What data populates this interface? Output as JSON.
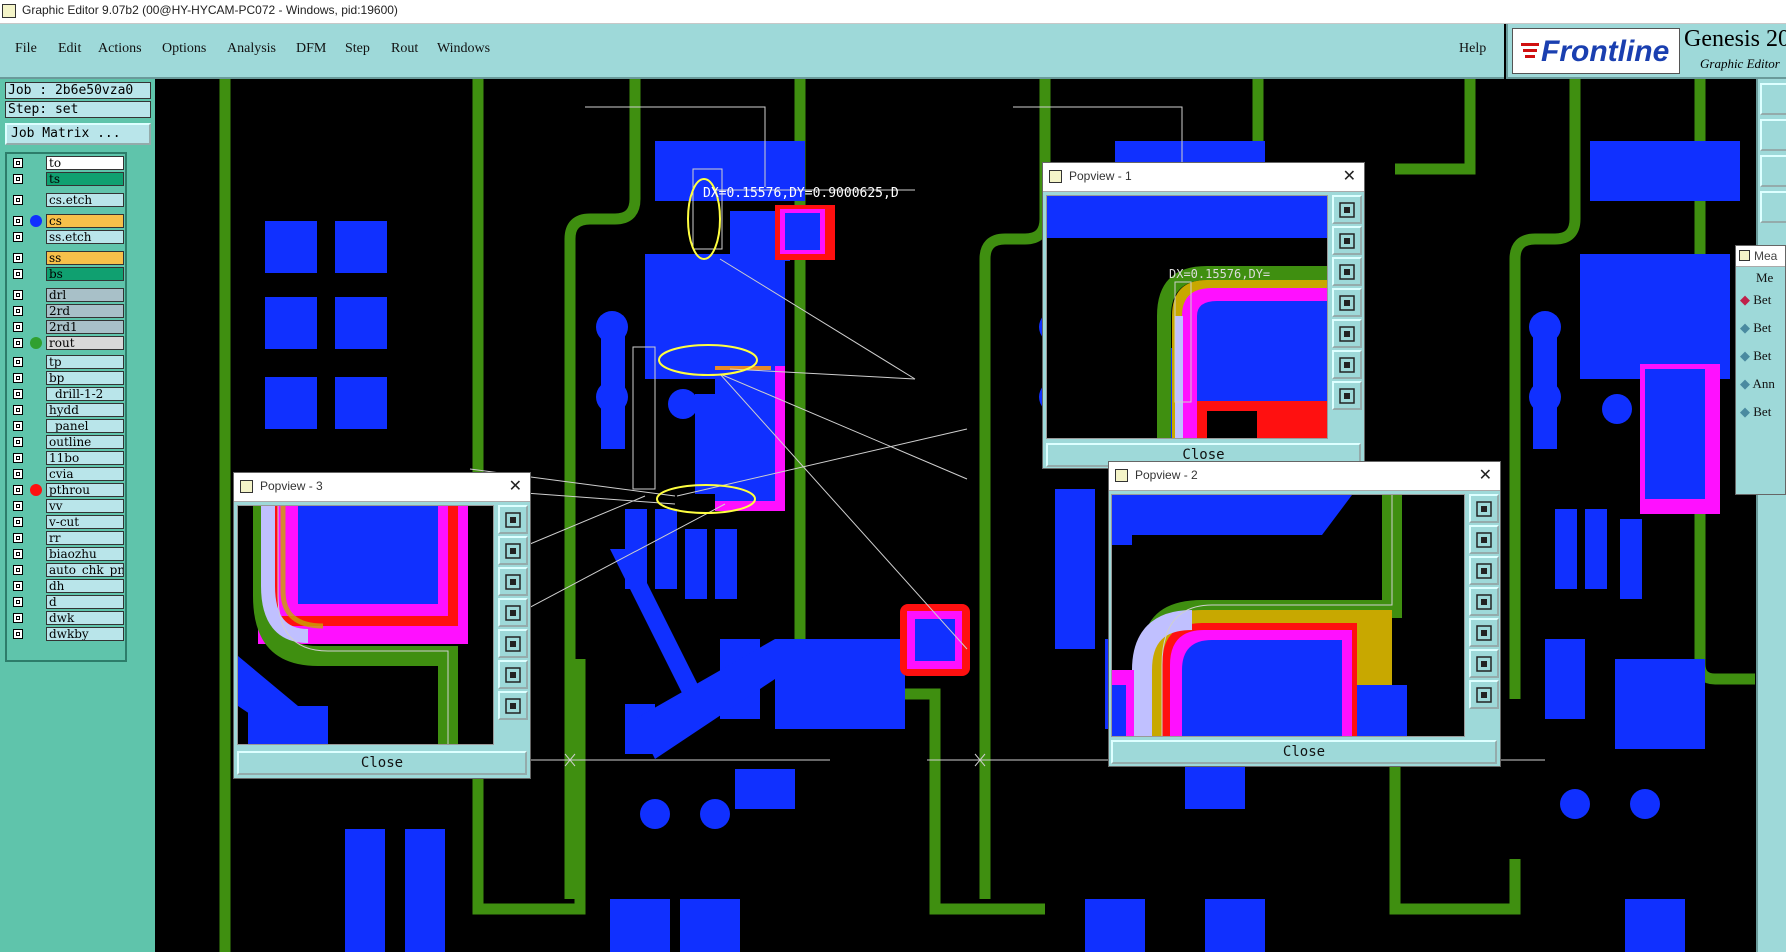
{
  "window": {
    "title": "Graphic Editor 9.07b2 (00@HY-HYCAM-PC072 - Windows, pid:19600)"
  },
  "menu": {
    "file": "File",
    "edit": "Edit",
    "actions": "Actions",
    "options": "Options",
    "analysis": "Analysis",
    "dfm": "DFM",
    "step": "Step",
    "rout": "Rout",
    "windows": "Windows",
    "help": "Help"
  },
  "brand": {
    "logo": "Frontline",
    "product": "Genesis 20",
    "subtitle": "Graphic Editor"
  },
  "job": {
    "job_line": "Job : 2b6e50vza0",
    "step_line": "Step: set",
    "matrix_button": "Job Matrix ..."
  },
  "layers": [
    {
      "name": "to",
      "color": "#ffffff",
      "dot": ""
    },
    {
      "name": "ts",
      "color": "#10a070",
      "dot": ""
    },
    {
      "name": "cs.etch",
      "color": "#b9e5ea",
      "dot": ""
    },
    {
      "name": "cs",
      "color": "#f7c04a",
      "dot": "#1030ff"
    },
    {
      "name": "ss.etch",
      "color": "#b9e5ea",
      "dot": ""
    },
    {
      "name": "ss",
      "color": "#f7c04a",
      "dot": ""
    },
    {
      "name": "bs",
      "color": "#10a070",
      "dot": ""
    },
    {
      "name": "drl",
      "color": "#a8c0c8",
      "dot": ""
    },
    {
      "name": "2rd",
      "color": "#a8c0c8",
      "dot": ""
    },
    {
      "name": "2rd1",
      "color": "#a8c0c8",
      "dot": ""
    },
    {
      "name": "rout",
      "color": "#d8d8d8",
      "dot": "#30a030"
    },
    {
      "name": "tp",
      "color": "#b9e5ea",
      "dot": ""
    },
    {
      "name": "bp",
      "color": "#b9e5ea",
      "dot": ""
    },
    {
      "name": "_drill-1-2",
      "color": "#b9e5ea",
      "dot": ""
    },
    {
      "name": "hydd",
      "color": "#b9e5ea",
      "dot": ""
    },
    {
      "name": "_panel",
      "color": "#b9e5ea",
      "dot": ""
    },
    {
      "name": "outline",
      "color": "#b9e5ea",
      "dot": ""
    },
    {
      "name": "11bo",
      "color": "#b9e5ea",
      "dot": ""
    },
    {
      "name": "cvia",
      "color": "#b9e5ea",
      "dot": ""
    },
    {
      "name": "pthrou",
      "color": "#b9e5ea",
      "dot": "#ff1010"
    },
    {
      "name": "vv",
      "color": "#b9e5ea",
      "dot": ""
    },
    {
      "name": "v-cut",
      "color": "#b9e5ea",
      "dot": ""
    },
    {
      "name": "rr",
      "color": "#b9e5ea",
      "dot": ""
    },
    {
      "name": "biaozhu",
      "color": "#b9e5ea",
      "dot": ""
    },
    {
      "name": "auto_chk_pnl",
      "color": "#b9e5ea",
      "dot": ""
    },
    {
      "name": "dh",
      "color": "#b9e5ea",
      "dot": ""
    },
    {
      "name": "d",
      "color": "#b9e5ea",
      "dot": ""
    },
    {
      "name": "dwk",
      "color": "#b9e5ea",
      "dot": ""
    },
    {
      "name": "dwkby",
      "color": "#b9e5ea",
      "dot": ""
    }
  ],
  "canvas": {
    "measure_text": "DX=0.15576,DY=0.9000625,D",
    "popview_measure_text": "DX=0.15576,DY="
  },
  "popview1": {
    "title": "Popview - 1",
    "close": "Close"
  },
  "popview2": {
    "title": "Popview - 2",
    "close": "Close"
  },
  "popview3": {
    "title": "Popview - 3",
    "close": "Close"
  },
  "measure_panel": {
    "title": "Mea",
    "header": "Me",
    "rows": [
      "Bet",
      "Bet",
      "Bet",
      "Ann",
      "Bet"
    ]
  },
  "colors": {
    "copper": "#1030ff",
    "mask": "#ff10ff",
    "pad": "#ff1010",
    "rout": "#3f8f10",
    "bg": "#000000",
    "panel": "#9ed9d9",
    "highlight": "#ffff40"
  }
}
